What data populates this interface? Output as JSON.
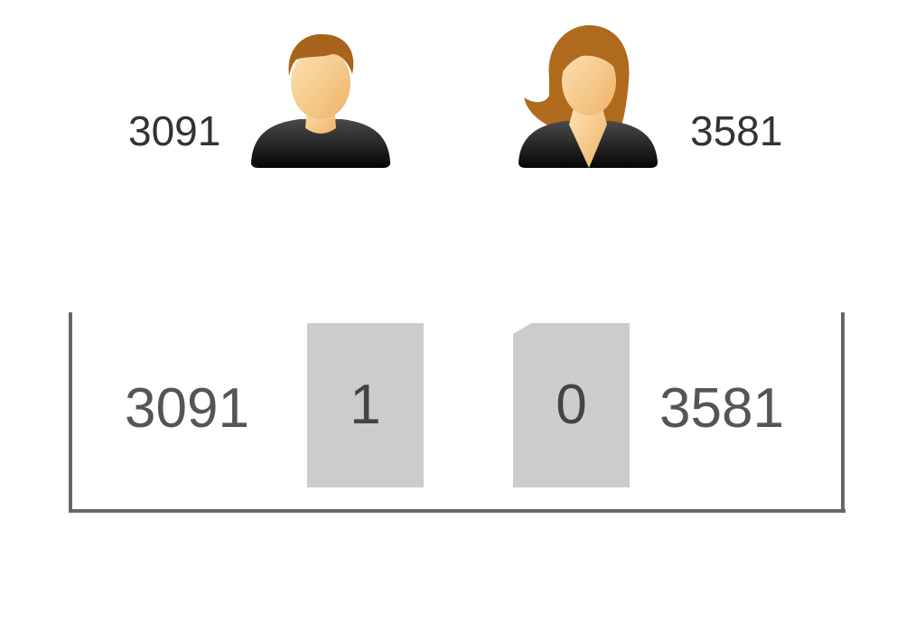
{
  "top": {
    "male_value": "3091",
    "female_value": "3581"
  },
  "bracket": {
    "left_value": "3091",
    "right_value": "3581",
    "left_box_label": "1",
    "right_box_label": "0"
  },
  "colors": {
    "box": "#cccccc",
    "bracket": "#666666",
    "text_dark": "#333333",
    "text_mid": "#555555",
    "male_hair": "#a8641c",
    "female_hair": "#b06a1e",
    "skin": "#f6c98a",
    "shirt": "#1a1a1a"
  },
  "icons": {
    "male": "male-user-icon",
    "female": "female-user-icon"
  }
}
